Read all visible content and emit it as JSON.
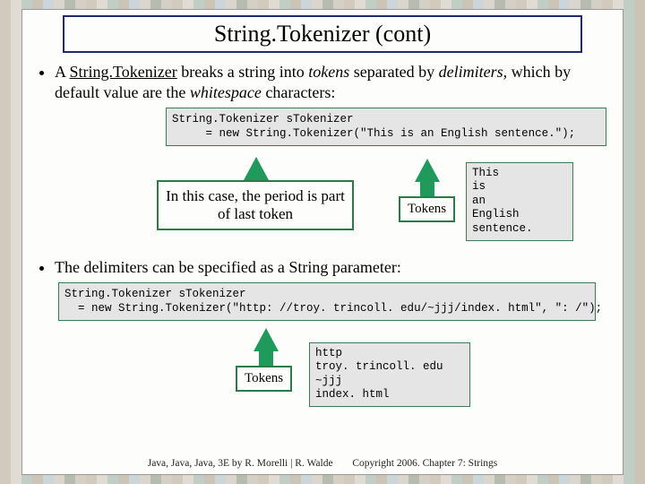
{
  "title": "String.Tokenizer (cont)",
  "bullets": {
    "b1_pre": "A ",
    "b1_cls": "String.Tokenizer",
    "b1_mid": " breaks a string into ",
    "b1_tokens": "tokens",
    "b1_sep": " separated by ",
    "b1_delims": "delimiters",
    "b1_post1": ", which by default value are the ",
    "b1_ws": "whitespace",
    "b1_post2": " characters:",
    "b2_pre": "The delimiters can be specified as a ",
    "b2_str": "String",
    "b2_post": " parameter:"
  },
  "code1": "String.Tokenizer sTokenizer\n     = new String.Tokenizer(\"This is an English sentence.\");",
  "caption1": "In this case, the period is part of last token",
  "tokens_label": "Tokens",
  "tokens_out1": "This\nis\nan\nEnglish\nsentence.",
  "code2": "String.Tokenizer sTokenizer\n  = new String.Tokenizer(\"http: //troy. trincoll. edu/~jjj/index. html\", \": /\");",
  "tokens_out2": "http\ntroy. trincoll. edu\n~jjj\nindex. html",
  "footer": {
    "left": "Java, Java, Java, 3E by R. Morelli | R. Walde",
    "right": "Copyright 2006.  Chapter 7: Strings"
  }
}
